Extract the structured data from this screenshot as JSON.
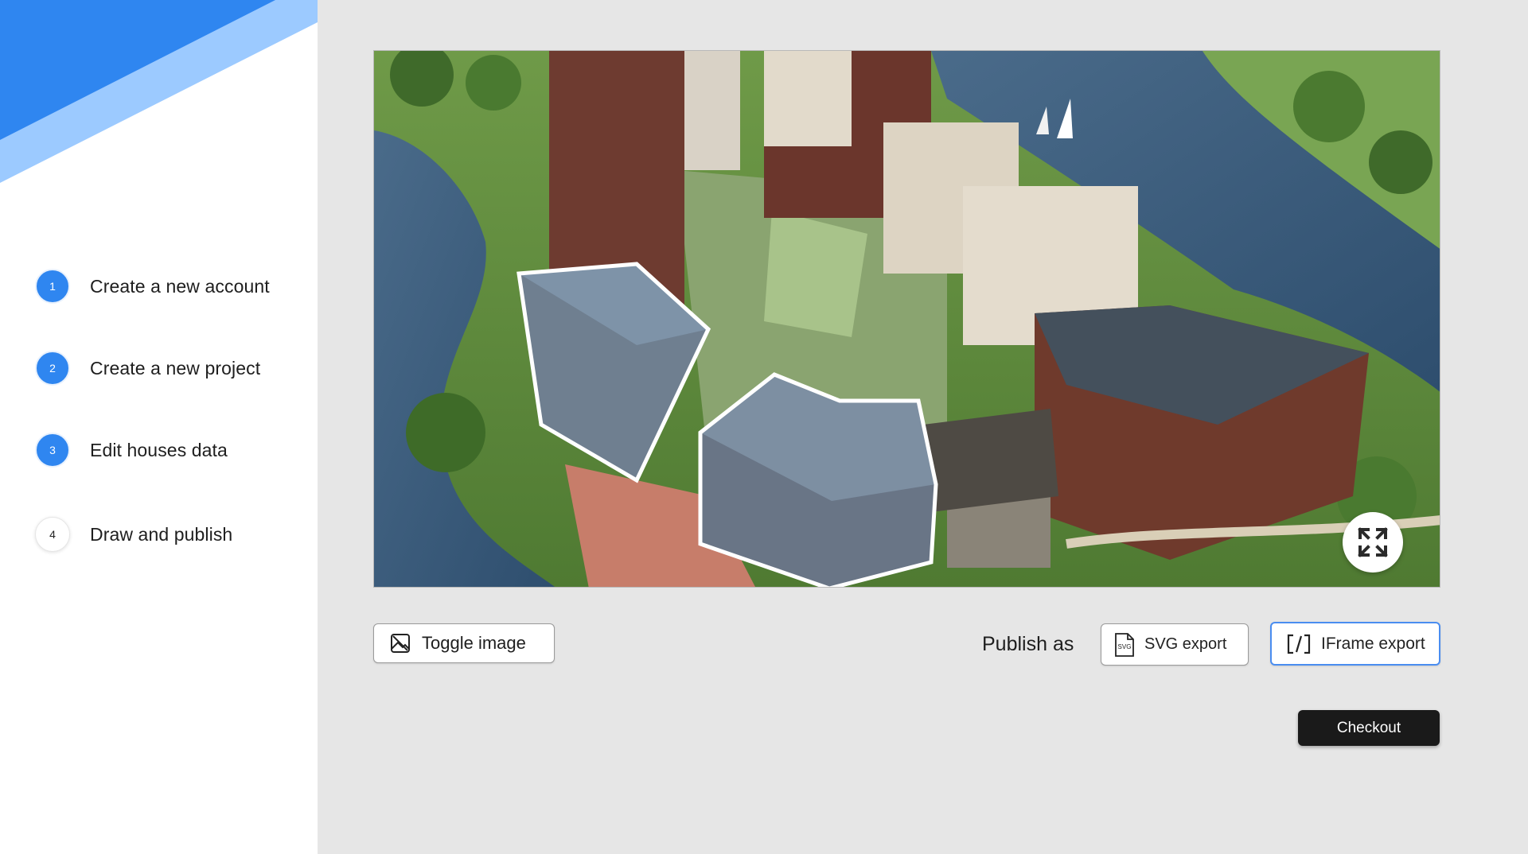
{
  "sidebar": {
    "steps": [
      {
        "number": "1",
        "label": "Create a new account",
        "state": "done"
      },
      {
        "number": "2",
        "label": "Create a new project",
        "state": "done"
      },
      {
        "number": "3",
        "label": "Edit houses data",
        "state": "done"
      },
      {
        "number": "4",
        "label": "Draw and publish",
        "state": "current"
      }
    ]
  },
  "viewer": {
    "image_description_icon": "expand-icon"
  },
  "toolbar": {
    "toggle_image_label": "Toggle image",
    "publish_as_label": "Publish as",
    "svg_export_label": "SVG export",
    "iframe_export_label": "IFrame export",
    "checkout_label": "Checkout"
  },
  "colors": {
    "accent": "#2f86f0",
    "accent_light": "#9ccaff",
    "background": "#e6e6e6",
    "checkout_bg": "#1a1a1a",
    "iframe_border": "#4a8df0"
  }
}
